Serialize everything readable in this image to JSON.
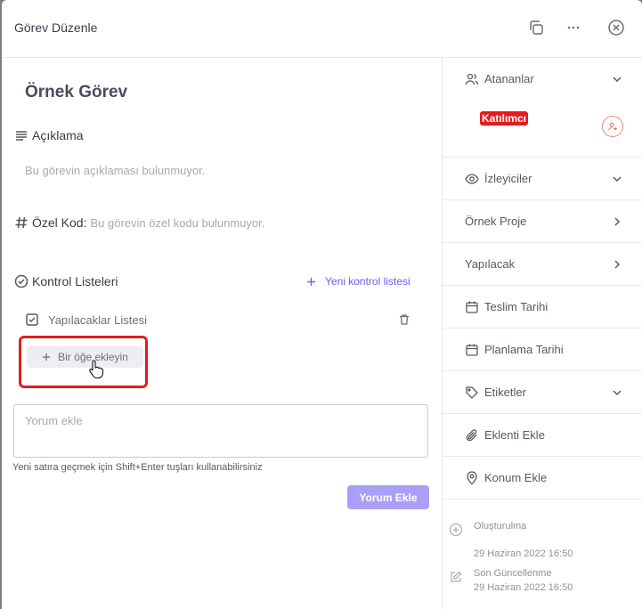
{
  "header": {
    "title": "Görev Düzenle"
  },
  "task": {
    "title": "Örnek Görev"
  },
  "description": {
    "label": "Açıklama",
    "empty_text": "Bu görevin açıklaması bulunmuyor."
  },
  "custom_code": {
    "label": "Özel Kod:",
    "empty_text": "Bu görevin özel kodu bulunmuyor."
  },
  "checklists": {
    "label": "Kontrol Listeleri",
    "new_label": "Yeni kontrol listesi",
    "items": [
      {
        "title": "Yapılacaklar Listesi",
        "add_item_label": "Bir öğe ekleyin"
      }
    ]
  },
  "comment": {
    "placeholder": "Yorum ekle",
    "hint": "Yeni satıra geçmek için Shift+Enter tuşları kullanabilirsiniz",
    "submit_label": "Yorum Ekle"
  },
  "sidebar": {
    "assignees": {
      "label": "Atananlar",
      "participant_badge": "Katılımcı"
    },
    "watchers": {
      "label": "İzleyiciler"
    },
    "project": {
      "label": "Örnek Proje"
    },
    "status": {
      "label": "Yapılacak"
    },
    "due_date": {
      "label": "Teslim Tarihi"
    },
    "plan_date": {
      "label": "Planlama Tarihi"
    },
    "tags": {
      "label": "Etiketler"
    },
    "attachment": {
      "label": "Eklenti Ekle"
    },
    "location": {
      "label": "Konum Ekle"
    },
    "created": {
      "label": "Oluşturulma",
      "value": "29 Haziran 2022 16:50"
    },
    "updated": {
      "label": "Son Güncellenme",
      "value": "29 Haziran 2022 16:50"
    }
  },
  "colors": {
    "accent": "#6a5cf0",
    "highlight": "#e31b1b",
    "button_disabled": "#aa9ff7"
  }
}
